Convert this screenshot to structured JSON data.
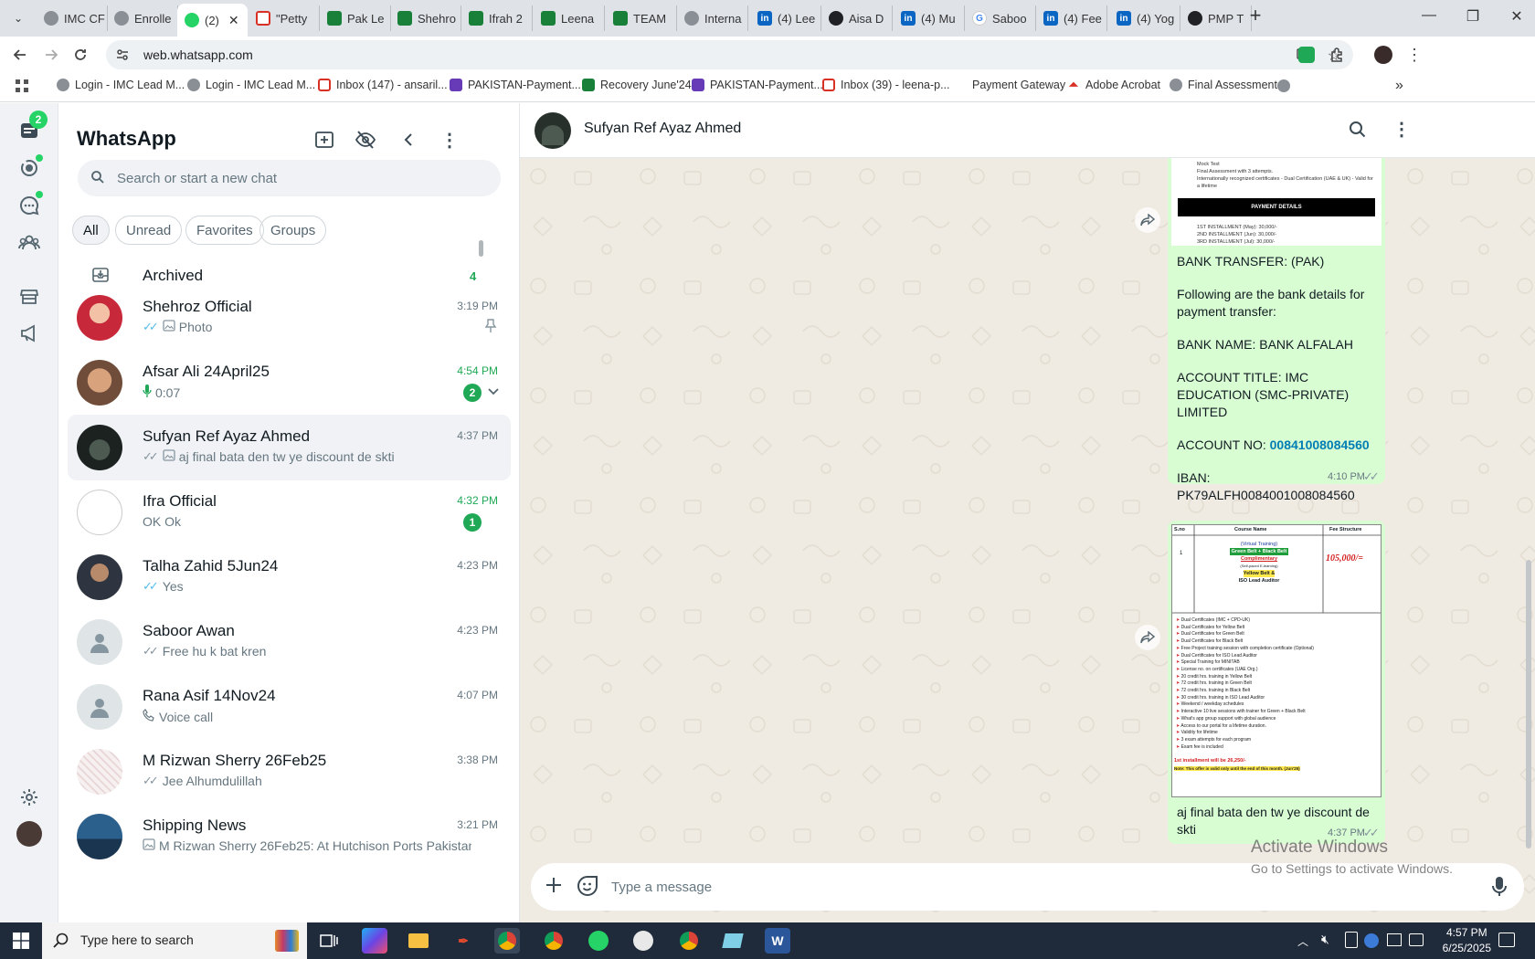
{
  "browser": {
    "tabs": [
      {
        "title": "IMC CF",
        "icon": "imc-icon",
        "active": false
      },
      {
        "title": "Enrolle",
        "icon": "imc-icon",
        "active": false
      },
      {
        "title": "(2)",
        "icon": "whatsapp-icon",
        "active": true
      },
      {
        "title": "\"Petty",
        "icon": "gmail-icon",
        "active": false
      },
      {
        "title": "Pak Le",
        "icon": "sheets-icon",
        "active": false
      },
      {
        "title": "Shehro",
        "icon": "sheets-icon",
        "active": false
      },
      {
        "title": "Ifrah 2",
        "icon": "sheets-icon",
        "active": false
      },
      {
        "title": "Leena",
        "icon": "sheets-icon",
        "active": false
      },
      {
        "title": "TEAM",
        "icon": "sheets-icon",
        "active": false
      },
      {
        "title": "Interna",
        "icon": "imc-icon",
        "active": false
      },
      {
        "title": "(4) Lee",
        "icon": "linkedin-icon",
        "active": false
      },
      {
        "title": "Aisa D",
        "icon": "github-icon",
        "active": false
      },
      {
        "title": "(4) Mu",
        "icon": "linkedin-icon",
        "active": false
      },
      {
        "title": "Saboo",
        "icon": "google-icon",
        "active": false
      },
      {
        "title": "(4) Fee",
        "icon": "linkedin-icon",
        "active": false
      },
      {
        "title": "(4) Yog",
        "icon": "linkedin-icon",
        "active": false
      },
      {
        "title": "PMP T",
        "icon": "github-icon",
        "active": false
      }
    ],
    "url": "web.whatsapp.com",
    "bookmarks": [
      {
        "label": "Login - IMC Lead M...",
        "icon": "imc-icon"
      },
      {
        "label": "Login - IMC Lead M...",
        "icon": "imc-icon"
      },
      {
        "label": "Inbox (147) - ansaril...",
        "icon": "gmail-icon"
      },
      {
        "label": "PAKISTAN-Payment...",
        "icon": "forms-icon"
      },
      {
        "label": "Recovery June'24",
        "icon": "sheets-icon"
      },
      {
        "label": "PAKISTAN-Payment...",
        "icon": "forms-icon"
      },
      {
        "label": "Inbox (39) - leena-p...",
        "icon": "gmail-icon"
      },
      {
        "label": "Payment Gateway",
        "icon": "adobe-icon"
      },
      {
        "label": "Adobe Acrobat",
        "icon": "acrobat-icon"
      },
      {
        "label": "Final Assessment",
        "icon": "imc-icon"
      }
    ]
  },
  "rail": {
    "chats_badge": "2",
    "colors": {
      "green": "#25d366"
    }
  },
  "chatlist": {
    "title": "WhatsApp",
    "search_placeholder": "Search or start a new chat",
    "filters": [
      "All",
      "Unread",
      "Favorites",
      "Groups"
    ],
    "archived_label": "Archived",
    "archived_count": "4",
    "chats": [
      {
        "name": "Shehroz Official",
        "time": "3:19 PM",
        "preview": "Photo",
        "ticks": "blue",
        "media": "photo",
        "pinned": true,
        "unread": "",
        "avatar": "photo-red"
      },
      {
        "name": "Afsar Ali 24April25",
        "time": "4:54 PM",
        "preview": "0:07",
        "media": "voice",
        "unread": "2",
        "avatar": "photo-face"
      },
      {
        "name": "Sufyan Ref Ayaz Ahmed",
        "time": "4:37 PM",
        "preview": "aj final bata den tw ye discount de skti",
        "ticks": "grey",
        "media": "photo",
        "selected": true,
        "avatar": "photo-dark"
      },
      {
        "name": "Ifra Official",
        "time": "4:32 PM",
        "preview": "OK Ok",
        "unread": "1",
        "avatar": "imc-logo"
      },
      {
        "name": "Talha Zahid 5Jun24",
        "time": "4:23 PM",
        "preview": "Yes",
        "ticks": "blue",
        "avatar": "photo-man"
      },
      {
        "name": "Saboor Awan",
        "time": "4:23 PM",
        "preview": "Free hu k bat kren",
        "ticks": "grey",
        "avatar": "default"
      },
      {
        "name": "Rana Asif 14Nov24",
        "time": "4:07 PM",
        "preview": "Voice call",
        "media": "call",
        "avatar": "default"
      },
      {
        "name": "M Rizwan Sherry 26Feb25",
        "time": "3:38 PM",
        "preview": "Jee Alhumdulillah",
        "ticks": "grey",
        "avatar": "photo-pattern"
      },
      {
        "name": "Shipping News",
        "time": "3:21 PM",
        "preview": "M Rizwan Sherry 26Feb25: At Hutchison Ports Pakistan, ...",
        "media": "photo",
        "avatar": "photo-ship"
      }
    ]
  },
  "conversation": {
    "contact_name": "Sufyan Ref Ayaz Ahmed",
    "composer_placeholder": "Type a message",
    "doc_top": {
      "lines": [
        "Mock Test",
        "Final Assessment with 3 attempts.",
        "Internationally recognized certificates - Dual Certification (UAE & UK) - Valid for a lifetime"
      ],
      "heading": "PAYMENT DETAILS",
      "installments": [
        "1ST INSTALLMENT (May): 30,000/-",
        "2ND INSTALLMENT (Jun): 30,000/-",
        "3RD INSTALLMENT (Jul): 30,000/-"
      ]
    },
    "bank_message": {
      "line1": "BANK TRANSFER: (PAK)",
      "line2": "Following are the bank details for payment transfer:",
      "line3": "BANK NAME: BANK ALFALAH",
      "line4": "ACCOUNT TITLE: IMC EDUCATION (SMC-PRIVATE) LIMITED",
      "account_label": "ACCOUNT NO: ",
      "account_no": "00841008084560",
      "iban": "IBAN: PK79ALFH0084001008084560",
      "time": "4:10 PM"
    },
    "fee_doc": {
      "headers": [
        "S.no",
        "Course Name",
        "Fee Structure"
      ],
      "row_no": "1",
      "course_lines": [
        "(Virtual Training)",
        "Green Belt + Black Belt",
        "Complimentary",
        "(Self-paced E-learning)",
        "Yellow Belt &",
        "ISO Lead Auditor"
      ],
      "fee": "105,000/=",
      "features": [
        "Dual Certificates (IMC + CPD-UK)",
        "Dual Certificates for Yellow Belt",
        "Dual Certificates for Green Belt",
        "Dual Certificates for Black Belt",
        "Free Project training session with completion certificate (Optional)",
        "Dual Certificates for ISO Lead Auditor",
        "Special Training for MINITAB",
        "License no. on certificates (UAE Org.)",
        "20 credit hrs. training in Yellow Belt",
        "72 credit hrs. training in Green Belt",
        "72 credit hrs. training in Black Belt",
        "30 credit hrs. training in ISO Lead Auditor",
        "Weekend / weekday schedules",
        "Interactive 10 live sessions with trainer for Green + Black Belt",
        "What's app group support with global audience",
        "Access to our portal for a lifetime duration.",
        "Validity for lifetime",
        "3 exam attempts for each program",
        "Exam fee is included"
      ],
      "installment": "1st installment will be 26,250/-",
      "note": "Note: This offer is valid only until the end of this month. (Jun'25)"
    },
    "last_message": {
      "text": "aj final bata den tw ye discount de skti",
      "time": "4:37 PM"
    },
    "activate": {
      "title": "Activate Windows",
      "subtitle": "Go to Settings to activate Windows."
    }
  },
  "taskbar": {
    "search_placeholder": "Type here to search",
    "time": "4:57 PM",
    "date": "6/25/2025"
  }
}
